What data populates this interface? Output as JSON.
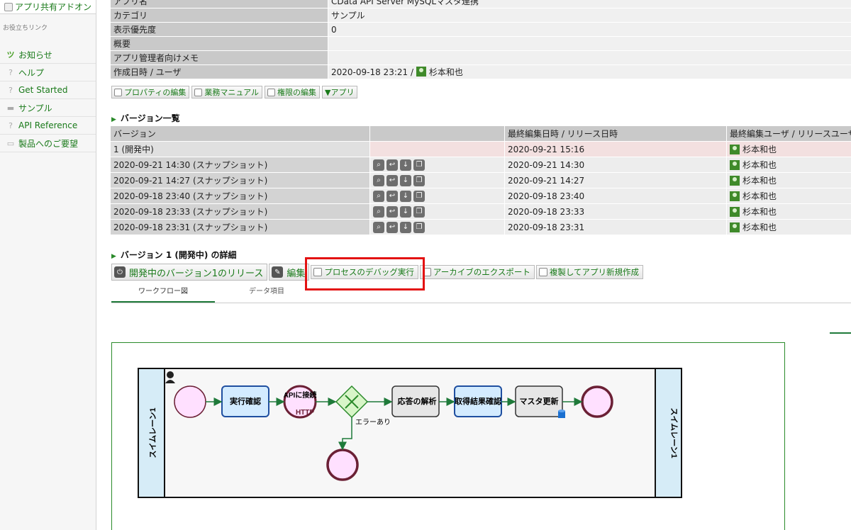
{
  "sidebar": {
    "top_item": "アプリ共有アドオン",
    "section_label": "お役立ちリンク",
    "items": [
      {
        "label": "お知らせ",
        "icon": "sprout-icon"
      },
      {
        "label": "ヘルプ",
        "icon": "question-icon"
      },
      {
        "label": "Get Started",
        "icon": "question-icon"
      },
      {
        "label": "サンプル",
        "icon": "sample-icon"
      },
      {
        "label": "API Reference",
        "icon": "question-icon"
      },
      {
        "label": "製品へのご要望",
        "icon": "request-icon"
      }
    ]
  },
  "properties": {
    "rows": [
      {
        "key": "アプリ名",
        "value": "CData API Server MySQLマスタ連携"
      },
      {
        "key": "カテゴリ",
        "value": "サンプル"
      },
      {
        "key": "表示優先度",
        "value": "0"
      },
      {
        "key": "概要",
        "value": ""
      },
      {
        "key": "アプリ管理者向けメモ",
        "value": ""
      },
      {
        "key": "作成日時 / ユーザ",
        "value": "2020-09-18 23:21 / ",
        "user": "杉本和也"
      }
    ]
  },
  "prop_buttons": [
    "プロパティの編集",
    "業務マニュアル",
    "権限の編集",
    "▼アプリ"
  ],
  "versions": {
    "title": "バージョン一覧",
    "headers": [
      "バージョン",
      "",
      "最終編集日時 / リリース日時",
      "最終編集ユーザ / リリースユーザ"
    ],
    "rows": [
      {
        "version": "1 (開発中)",
        "date": "2020-09-21 15:16",
        "user": "杉本和也"
      },
      {
        "version": "2020-09-21 14:30 (スナップショット)",
        "date": "2020-09-21 14:30",
        "user": "杉本和也"
      },
      {
        "version": "2020-09-21 14:27 (スナップショット)",
        "date": "2020-09-21 14:27",
        "user": "杉本和也"
      },
      {
        "version": "2020-09-18 23:40 (スナップショット)",
        "date": "2020-09-18 23:40",
        "user": "杉本和也"
      },
      {
        "version": "2020-09-18 23:33 (スナップショット)",
        "date": "2020-09-18 23:33",
        "user": "杉本和也"
      },
      {
        "version": "2020-09-18 23:31 (スナップショット)",
        "date": "2020-09-18 23:31",
        "user": "杉本和也"
      }
    ]
  },
  "detail": {
    "title": "バージョン 1 (開発中) の詳細",
    "release_button": "開発中のバージョン1のリリース",
    "edit_button": "編集",
    "debug_button": "プロセスのデバッグ実行",
    "export_button": "アーカイブのエクスポート",
    "copy_button": "複製してアプリ新規作成"
  },
  "tabs": [
    "ワークフロー図",
    "データ項目"
  ],
  "workflow": {
    "swimlane": "スイムレーン1",
    "tasks": {
      "confirm": "実行確認",
      "api": "APIに接続",
      "http": "HTTP",
      "parse": "応答の解析",
      "result": "取得結果確認",
      "master": "マスタ更新"
    },
    "error_label": "エラーあり"
  },
  "colors": {
    "link_green": "#1a7a1a",
    "header_gray": "#c9c9c9",
    "highlight": "#e31212",
    "task_blue": "#d3ebff",
    "event_pink": "#ffe0ff"
  }
}
